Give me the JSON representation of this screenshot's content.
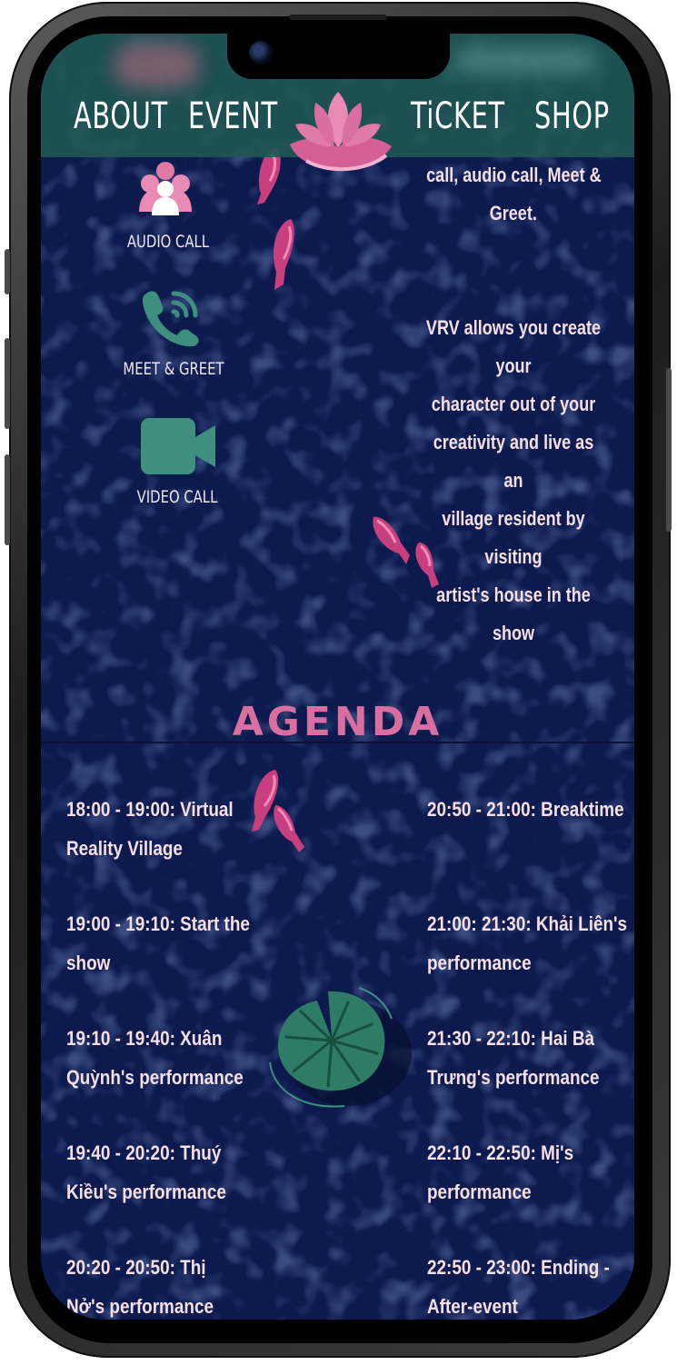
{
  "nav": {
    "left": [
      "ABOUT",
      "EVENT"
    ],
    "right": [
      "TiCKET",
      "SHOP"
    ]
  },
  "features": [
    {
      "label": "AUDIO CALL",
      "icon": "audio-call-icon"
    },
    {
      "label": "MEET & GREET",
      "icon": "phone-icon"
    },
    {
      "label": "VIDEO CALL",
      "icon": "video-camera-icon"
    }
  ],
  "right_text": {
    "top": [
      "call, audio call, Meet &",
      "Greet."
    ],
    "main": [
      "VRV allows you create your",
      "character out of your",
      "creativity and live as an",
      "village resident by visiting",
      "artist's house in the show"
    ]
  },
  "agenda": {
    "title": "AGENDA",
    "left": [
      [
        "18:00 - 19:00: Virtual",
        "Reality Village"
      ],
      [
        "19:00 - 19:10: Start the",
        "show"
      ],
      [
        "19:10 - 19:40: Xuân",
        "Quỳnh's performance"
      ],
      [
        "19:40 - 20:20: Thuý",
        "Kiều's performance"
      ],
      [
        "20:20 - 20:50: Thị",
        "Nở's performance"
      ]
    ],
    "right": [
      [
        "20:50 - 21:00: Breaktime"
      ],
      [
        "21:00: 21:30: Khải Liên's",
        "performance"
      ],
      [
        "21:30 - 22:10: Hai Bà",
        "Trưng's performance"
      ],
      [
        "22:10 - 22:50: Mị's",
        "performance"
      ],
      [
        "22:50 - 23:00: Ending -",
        "After-event"
      ]
    ]
  },
  "colors": {
    "background": "#0c1a4e",
    "header": "#205852",
    "accent_pink": "#d96fa0",
    "icon_green": "#3f8f7f",
    "text": "#f6dfe6"
  }
}
